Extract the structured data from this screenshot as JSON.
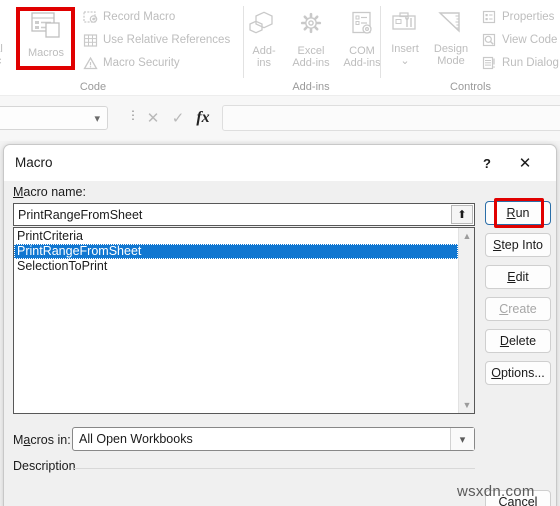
{
  "ribbon": {
    "groups": [
      {
        "name": "Code",
        "label": "Code",
        "big_buttons": [
          {
            "label": "Macros",
            "icon": "macros-icon",
            "disabled": true,
            "highlighted": true
          }
        ],
        "small_buttons": [
          {
            "label": "Record Macro",
            "icon": "record-macro-icon",
            "disabled": true
          },
          {
            "label": "Use Relative References",
            "icon": "relative-references-icon",
            "disabled": true
          },
          {
            "label": "Macro Security",
            "icon": "macro-security-icon",
            "disabled": true
          }
        ]
      },
      {
        "name": "Add-ins",
        "label": "Add-ins",
        "big_buttons": [
          {
            "label_line1": "Add-",
            "label_line2": "ins",
            "icon": "addins-icon",
            "disabled": true
          },
          {
            "label_line1": "Excel",
            "label_line2": "Add-ins",
            "icon": "excel-addins-icon",
            "disabled": true
          },
          {
            "label_line1": "COM",
            "label_line2": "Add-ins",
            "icon": "com-addins-icon",
            "disabled": true
          }
        ]
      },
      {
        "name": "Controls",
        "label": "Controls",
        "big_buttons": [
          {
            "label_line1": "Insert",
            "label_line2": "⌄",
            "icon": "insert-control-icon",
            "disabled": true
          },
          {
            "label_line1": "Design",
            "label_line2": "Mode",
            "icon": "design-mode-icon",
            "disabled": true
          }
        ],
        "small_buttons": [
          {
            "label": "Properties",
            "icon": "properties-icon",
            "disabled": true
          },
          {
            "label": "View Code",
            "icon": "view-code-icon",
            "disabled": true
          },
          {
            "label": "Run Dialog",
            "icon": "run-dialog-icon",
            "disabled": true
          }
        ]
      }
    ]
  },
  "formula_bar": {
    "name_box_value": "",
    "name_box_caret_icon": "chevron-down-icon",
    "cancel_icon": "close-icon",
    "enter_icon": "check-icon",
    "function_icon": "fx",
    "formula_value": ""
  },
  "dialog": {
    "title": "Macro",
    "help_icon": "?",
    "close_icon": "✕",
    "macro_name_label": "Macro name:",
    "macro_name_accel": "M",
    "macro_name_value": "PrintRangeFromSheet",
    "macro_name_placeholder": "",
    "macro_name_up_icon": "⬆",
    "list": {
      "items": [
        {
          "label": "PrintCriteria",
          "selected": false
        },
        {
          "label": "PrintRangeFromSheet",
          "selected": true
        },
        {
          "label": "SelectionToPrint",
          "selected": false
        }
      ],
      "scrollbar_up_icon": "▲",
      "scrollbar_down_icon": "▼"
    },
    "buttons": [
      {
        "id": "run",
        "label": "Run",
        "accel": "R",
        "disabled": false,
        "focused": true,
        "highlighted": true
      },
      {
        "id": "step-into",
        "label": "Step Into",
        "accel": "S",
        "disabled": false,
        "focused": false,
        "highlighted": false
      },
      {
        "id": "edit",
        "label": "Edit",
        "accel": "E",
        "disabled": false,
        "focused": false,
        "highlighted": false
      },
      {
        "id": "create",
        "label": "Create",
        "accel": "C",
        "disabled": true,
        "focused": false,
        "highlighted": false
      },
      {
        "id": "delete",
        "label": "Delete",
        "accel": "D",
        "disabled": false,
        "focused": false,
        "highlighted": false
      },
      {
        "id": "options",
        "label": "Options...",
        "accel": "O",
        "disabled": false,
        "focused": false,
        "highlighted": false
      }
    ],
    "macros_in_label": "Macros in:",
    "macros_in_value": "All Open Workbooks",
    "macros_in_caret_icon": "chevron-down-icon",
    "macros_in_options": [
      "All Open Workbooks"
    ],
    "description_label": "Description",
    "description_value": "",
    "cancel_label": "Cancel"
  },
  "watermark": {
    "text": "wsxdn.com"
  },
  "colors": {
    "accent_selection": "#1177d1",
    "highlight_red": "#e00000",
    "dialog_bg": "#f0f0f0",
    "disabled_text": "#bdbdbd"
  }
}
